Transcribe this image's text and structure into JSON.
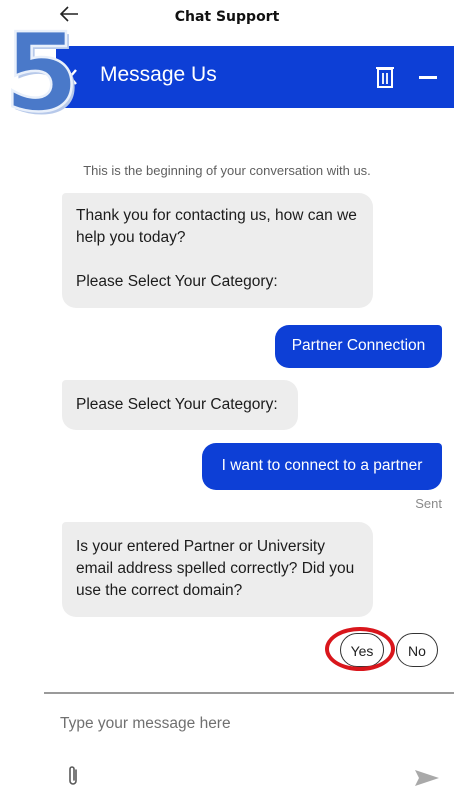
{
  "top_bar": {
    "back_icon": "arrow-left-icon",
    "title": "Chat Support"
  },
  "step_marker": "5",
  "header": {
    "back_icon": "chevron-left-icon",
    "title": "Message Us",
    "delete_icon": "trash-icon",
    "minimize_icon": "minimize-icon",
    "color": "#0d3fd6"
  },
  "conversation": {
    "start_notice": "This is the beginning of your conversation with us.",
    "messages": [
      {
        "from": "bot",
        "lines": [
          "Thank you for contacting us, how can we help you today?",
          "Please Select Your Category:"
        ]
      },
      {
        "from": "user",
        "text": "Partner Connection"
      },
      {
        "from": "bot",
        "text": "Please Select Your Category:"
      },
      {
        "from": "user",
        "text": "I want to connect to a partner"
      },
      {
        "from": "bot",
        "text": "Is your entered Partner or University email address spelled correctly? Did you use the correct domain?"
      }
    ],
    "sent_status": "Sent",
    "options": [
      "Yes",
      "No"
    ],
    "highlight_color": "#d9161c"
  },
  "composer": {
    "placeholder": "Type your message here",
    "attach_icon": "paperclip-icon",
    "send_icon": "send-icon"
  }
}
